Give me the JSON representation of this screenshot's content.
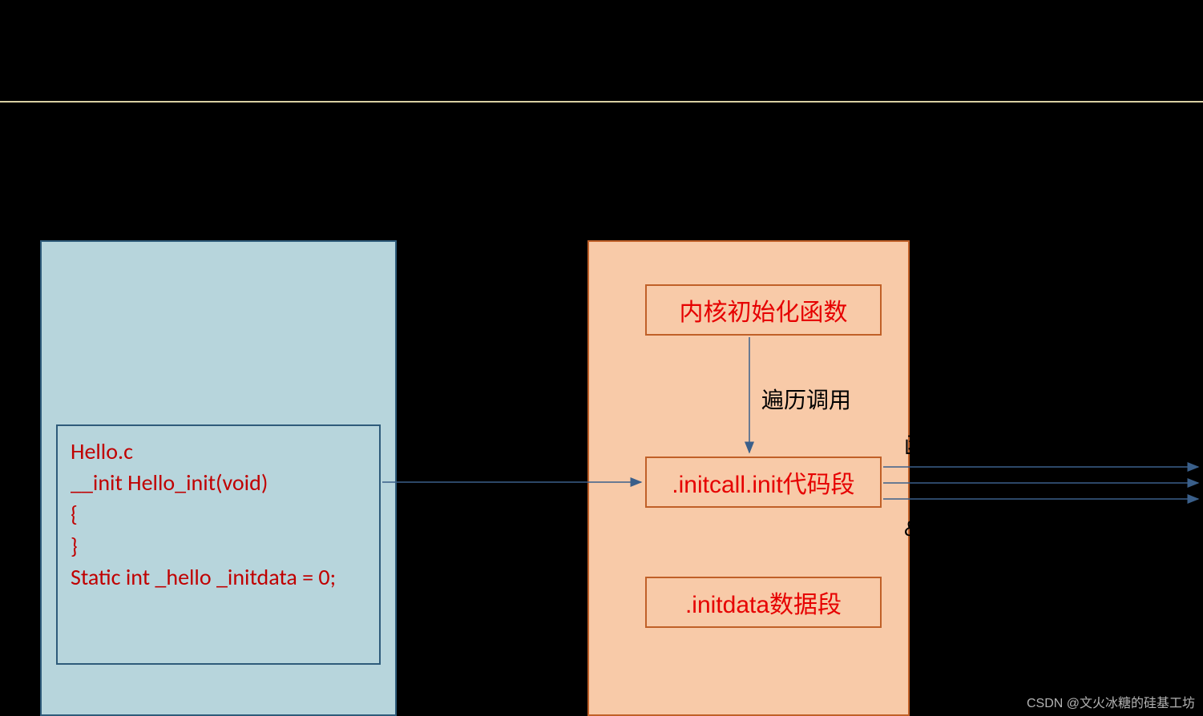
{
  "codebox": {
    "line1": "Hello.c",
    "line2": "__init Hello_init(void)",
    "line3": "{",
    "line4": "}",
    "line5": "",
    "line6": "Static int _hello _initdata = 0;"
  },
  "boxes": {
    "kernel": "内核初始化函数",
    "initcall": ".initcall.init代码段",
    "initdata": ".initdata数据段"
  },
  "labels": {
    "traverse": "遍历调用",
    "func": "函数",
    "hello": "&he"
  },
  "watermark": "CSDN @文火冰糖的硅基工坊",
  "colors": {
    "leftPanel": "#b7d5dc",
    "rightPanel": "#f8caa8",
    "codeText": "#c00000",
    "boxText": "#e60000",
    "arrow": "#3a5f8a"
  }
}
